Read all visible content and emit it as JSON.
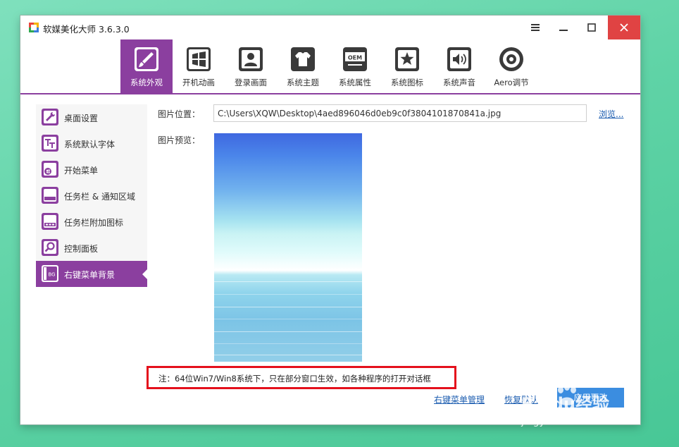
{
  "window": {
    "title": "软媒美化大师 3.6.3.0",
    "controls": {
      "menu": "≡",
      "minimize": "—",
      "maximize": "☐",
      "close": "✕"
    }
  },
  "toolbar": {
    "tabs": [
      {
        "label": "系统外观",
        "icon": "brush-icon",
        "active": true
      },
      {
        "label": "开机动画",
        "icon": "windows-logo-icon",
        "active": false
      },
      {
        "label": "登录画面",
        "icon": "user-portrait-icon",
        "active": false
      },
      {
        "label": "系统主题",
        "icon": "tshirt-icon",
        "active": false
      },
      {
        "label": "系统属性",
        "icon": "oem-icon",
        "active": false
      },
      {
        "label": "系统图标",
        "icon": "star-icon",
        "active": false
      },
      {
        "label": "系统声音",
        "icon": "speaker-icon",
        "active": false
      },
      {
        "label": "Aero调节",
        "icon": "aero-circle-icon",
        "active": false
      }
    ],
    "oem_text": "OEM"
  },
  "sidebar": {
    "items": [
      {
        "label": "桌面设置",
        "icon": "wrench-icon",
        "active": false
      },
      {
        "label": "系统默认字体",
        "icon": "font-icon",
        "active": false
      },
      {
        "label": "开始菜单",
        "icon": "start-menu-icon",
        "active": false
      },
      {
        "label": "任务栏 & 通知区域",
        "icon": "taskbar-icon",
        "active": false
      },
      {
        "label": "任务栏附加图标",
        "icon": "taskbar-addon-icon",
        "active": false
      },
      {
        "label": "控制面板",
        "icon": "magnifier-icon",
        "active": false
      },
      {
        "label": "右键菜单背景",
        "icon": "bg-icon",
        "active": true
      }
    ],
    "bg_icon_text": "BG"
  },
  "main": {
    "image_location_label": "图片位置：",
    "image_path": "C:\\Users\\XQW\\Desktop\\4aed896046d0eb9c0f3804101870841a.jpg",
    "browse_link": "浏览...",
    "image_preview_label": "图片预览：",
    "note": "注：64位Win7/Win8系统下，只在部分窗口生效，如各种程序的打开对话框",
    "context_menu_manage_link": "右键菜单管理",
    "restore_default_link": "恢复默认",
    "apply_button": "应用更改"
  },
  "watermark": {
    "brand": "Baidu经验",
    "url": "jingyan.baidu.com"
  },
  "colors": {
    "accent": "#8b3f9f",
    "close": "#e04343",
    "link": "#1c5db0",
    "note_border": "#e4101c"
  }
}
